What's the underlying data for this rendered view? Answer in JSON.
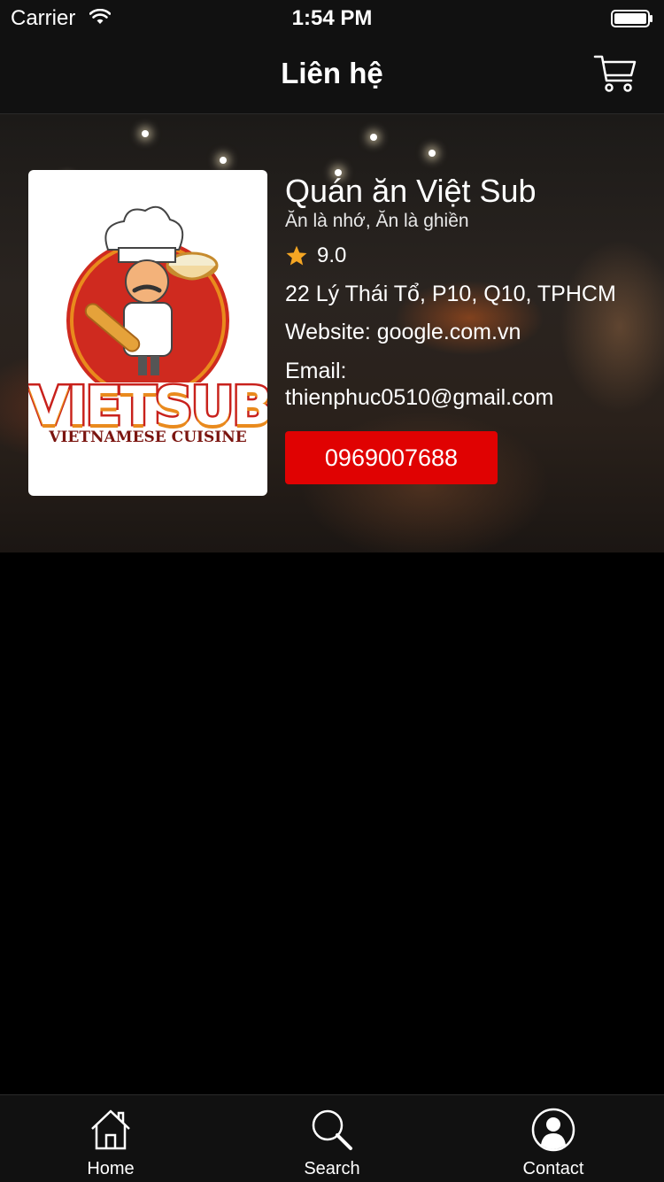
{
  "status_bar": {
    "carrier": "Carrier",
    "time": "1:54 PM"
  },
  "nav": {
    "title": "Liên hệ",
    "cart_icon": "cart-icon"
  },
  "logo": {
    "word": "VIETSUB",
    "subtitle": "VIETNAMESE CUISINE"
  },
  "restaurant": {
    "name": "Quán ăn Việt Sub",
    "slogan": "Ăn là nhớ, Ăn là ghiền",
    "rating": "9.0",
    "address": "22 Lý Thái Tổ, P10, Q10, TPHCM",
    "website": "Website: google.com.vn",
    "email_label": "Email:",
    "email": "thienphuc0510@gmail.com",
    "phone": "0969007688"
  },
  "colors": {
    "accent": "#e00202",
    "star": "#f5a623",
    "background": "#000000",
    "bar": "#111111"
  },
  "tab_bar": [
    {
      "label": "Home",
      "icon": "home-icon"
    },
    {
      "label": "Search",
      "icon": "search-icon"
    },
    {
      "label": "Contact",
      "icon": "contact-icon"
    }
  ]
}
